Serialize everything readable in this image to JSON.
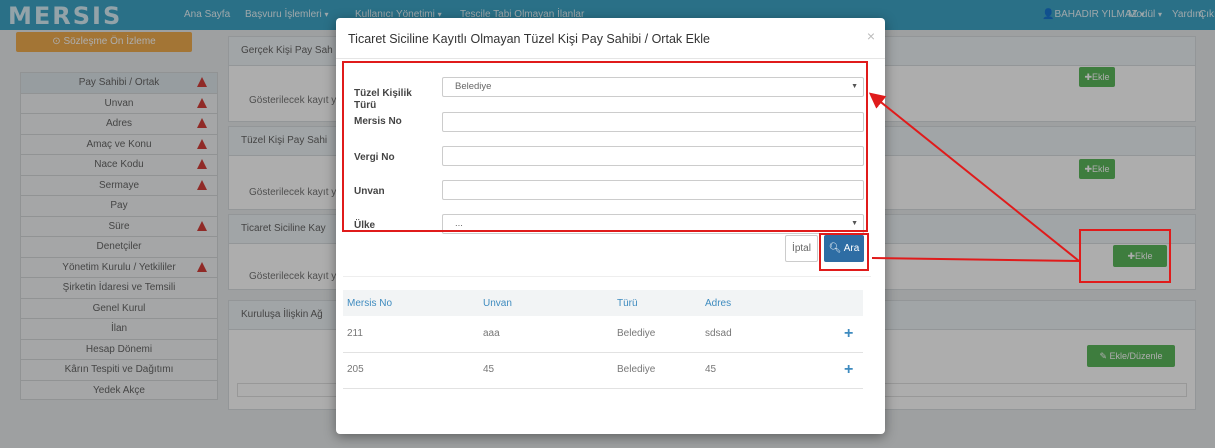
{
  "navbar": {
    "brand": "MERSIS",
    "links": [
      "Ana Sayfa",
      "Başvuru İşlemleri",
      "Kullanıcı Yönetimi",
      "Tescile Tabi Olmayan İlanlar"
    ],
    "user": "BAHADIR YILMAZ",
    "modul": "Modül",
    "yardim": "Yardım",
    "cikis": "Çıkış"
  },
  "sidebar": {
    "top_button": "Sözleşme Ön İzleme",
    "items": [
      {
        "label": "Pay Sahibi / Ortak",
        "warn": true,
        "active": true
      },
      {
        "label": "Unvan",
        "warn": true
      },
      {
        "label": "Adres",
        "warn": true
      },
      {
        "label": "Amaç ve Konu",
        "warn": true
      },
      {
        "label": "Nace Kodu",
        "warn": true
      },
      {
        "label": "Sermaye",
        "warn": true
      },
      {
        "label": "Pay",
        "warn": false
      },
      {
        "label": "Süre",
        "warn": true
      },
      {
        "label": "Denetçiler",
        "warn": false
      },
      {
        "label": "Yönetim Kurulu / Yetkililer",
        "warn": true
      },
      {
        "label": "Şirketin İdaresi ve Temsili",
        "warn": false
      },
      {
        "label": "Genel Kurul",
        "warn": false
      },
      {
        "label": "İlan",
        "warn": false
      },
      {
        "label": "Hesap Dönemi",
        "warn": false
      },
      {
        "label": "Kârın Tespiti ve Dağıtımı",
        "warn": false
      },
      {
        "label": "Yedek Akçe",
        "warn": false
      }
    ]
  },
  "main": {
    "panel1_title": "Gerçek Kişi Pay Sah",
    "panel2_title": "Tüzel Kişi Pay Sahi",
    "panel3_title": "Ticaret Siciline Kay",
    "panel4_title": "Kuruluşa İlişkin Ağ",
    "empty_text": "Gösterilecek kayıt y",
    "ekle_label": "Ekle",
    "ekle_duzenle_label": "Ekle/Düzenle"
  },
  "modal": {
    "title": "Ticaret Siciline Kayıtlı Olmayan Tüzel Kişi Pay Sahibi / Ortak Ekle",
    "close": "×",
    "fields": {
      "tur_label": "Tüzel Kişilik Türü",
      "tur_value": "Belediye",
      "mersis_label": "Mersis No",
      "mersis_value": "",
      "vergi_label": "Vergi No",
      "vergi_value": "",
      "unvan_label": "Unvan",
      "unvan_value": "",
      "ulke_label": "Ülke",
      "ulke_value": "..."
    },
    "iptal_label": "İptal",
    "ara_label": "Ara",
    "table": {
      "headers": [
        "Mersis No",
        "Unvan",
        "Türü",
        "Adres"
      ],
      "rows": [
        [
          "211",
          "aaa",
          "Belediye",
          "sdsad"
        ],
        [
          "205",
          "45",
          "Belediye",
          "45"
        ]
      ]
    }
  },
  "colors": {
    "navbar": "#3fa6c8",
    "annotation_red": "#e01b1b",
    "primary": "#2e6da4",
    "success": "#5cb85c",
    "warning": "#d43f3a"
  }
}
